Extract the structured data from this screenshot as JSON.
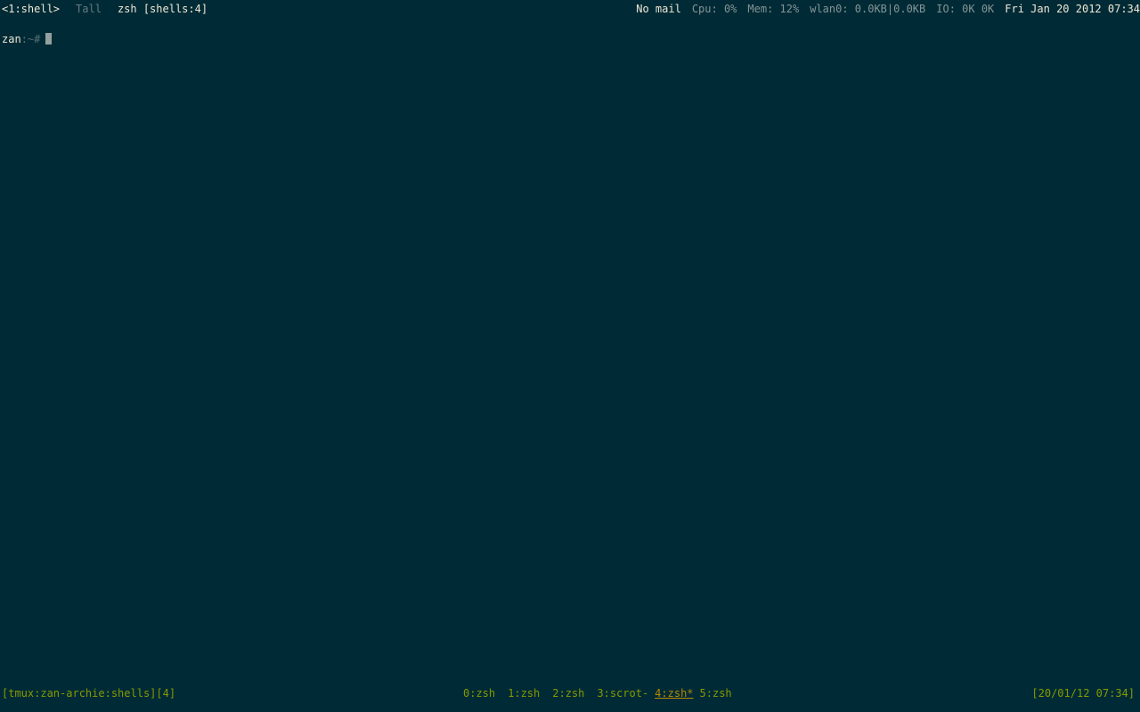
{
  "topbar": {
    "workspace": "<1:shell>",
    "layout": "Tall",
    "window_title": "zsh [shells:4]",
    "mail": "No mail",
    "cpu": "Cpu: 0%",
    "mem": "Mem: 12%",
    "network": "wlan0: 0.0KB|0.0KB",
    "io": "IO: 0K 0K",
    "datetime": "Fri Jan 20 2012 07:34"
  },
  "terminal": {
    "user": "zan",
    "separator": ":",
    "dir": "~",
    "prompt_char": "#"
  },
  "tmux": {
    "session": "[tmux:zan-archie:shells][4]",
    "windows": [
      {
        "label": "0:zsh",
        "active": false
      },
      {
        "label": "1:zsh",
        "active": false
      },
      {
        "label": "2:zsh",
        "active": false
      },
      {
        "label": "3:scrot-",
        "active": false
      },
      {
        "label": "4:zsh*",
        "active": true
      },
      {
        "label": "5:zsh",
        "active": false
      }
    ],
    "clock": "[20/01/12 07:34]"
  },
  "colors": {
    "background": "#002b36",
    "foreground": "#eee8d5",
    "tmux_green": "#859900",
    "tmux_active": "#b58900"
  }
}
